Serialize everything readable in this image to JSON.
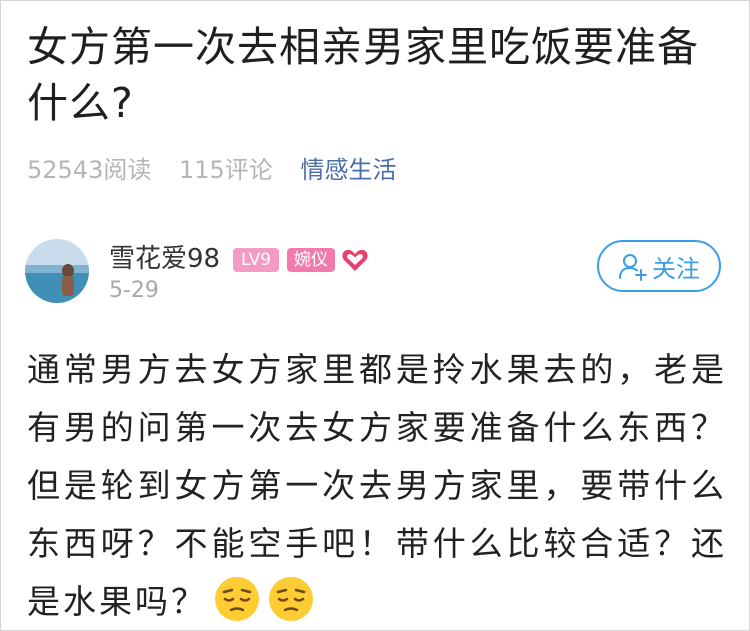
{
  "question": {
    "title": "女方第一次去相亲男家里吃饭要准备什么?",
    "reads": "52543阅读",
    "comments": "115评论",
    "category": "情感生活"
  },
  "author": {
    "name": "雪花爱98",
    "level_badge": "LV9",
    "title_badge": "婉仪",
    "date": "5-29",
    "avatar_icon": "beach-photo-avatar",
    "heart_icon": "heart-icon",
    "heart_color": "#e8406e"
  },
  "actions": {
    "follow_label": "关注",
    "accent_color": "#3a9ee6"
  },
  "body": {
    "text": "通常男方去女方家里都是拎水果去的，老是有男的问第一次去女方家要准备什么东西？但是轮到女方第一次去男方家里，要带什么东西呀？不能空手吧！带什么比较合适？还是水果吗？",
    "emoji_icon": "pensive-face-emoji"
  }
}
